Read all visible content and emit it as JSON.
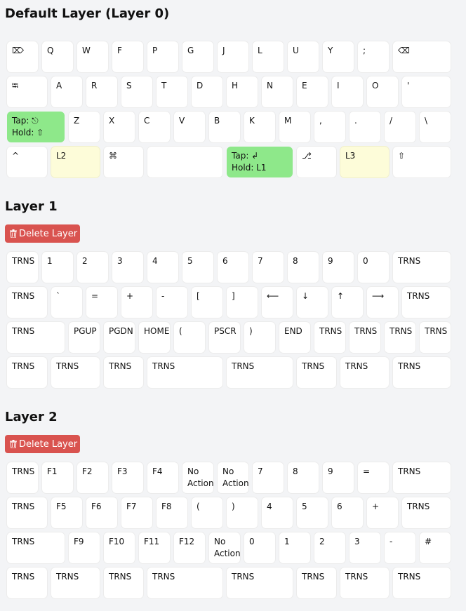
{
  "layers": [
    {
      "title": "Default Layer (Layer 0)",
      "delete_label": null,
      "rows": [
        [
          [
            "⌦"
          ],
          [
            "Q"
          ],
          [
            "W"
          ],
          [
            "F"
          ],
          [
            "P"
          ],
          [
            "G"
          ],
          [
            "J"
          ],
          [
            "L"
          ],
          [
            "U"
          ],
          [
            "Y"
          ],
          [
            ";"
          ],
          [
            "⌫"
          ]
        ],
        [
          [
            "⭾"
          ],
          [
            "A"
          ],
          [
            "R"
          ],
          [
            "S"
          ],
          [
            "T"
          ],
          [
            "D"
          ],
          [
            "H"
          ],
          [
            "N"
          ],
          [
            "E"
          ],
          [
            "I"
          ],
          [
            "O"
          ],
          [
            "'"
          ]
        ],
        [
          [
            "Tap: ⎋",
            "Hold: ⇧"
          ],
          [
            "Z"
          ],
          [
            "X"
          ],
          [
            "C"
          ],
          [
            "V"
          ],
          [
            "B"
          ],
          [
            "K"
          ],
          [
            "M"
          ],
          [
            ","
          ],
          [
            "."
          ],
          [
            "/"
          ],
          [
            "\\"
          ]
        ],
        [
          [
            "^"
          ],
          [
            "L2"
          ],
          [
            "⌘"
          ],
          [
            ""
          ],
          [
            "Tap: ↲",
            "Hold: L1"
          ],
          [
            "⎇"
          ],
          [
            "L3"
          ],
          [
            "⇧"
          ]
        ]
      ]
    },
    {
      "title": "Layer 1",
      "delete_label": "Delete Layer",
      "rows": [
        [
          [
            "TRNS"
          ],
          [
            "1"
          ],
          [
            "2"
          ],
          [
            "3"
          ],
          [
            "4"
          ],
          [
            "5"
          ],
          [
            "6"
          ],
          [
            "7"
          ],
          [
            "8"
          ],
          [
            "9"
          ],
          [
            "0"
          ],
          [
            "TRNS"
          ]
        ],
        [
          [
            "TRNS"
          ],
          [
            "`"
          ],
          [
            "="
          ],
          [
            "+"
          ],
          [
            "-"
          ],
          [
            "["
          ],
          [
            "]"
          ],
          [
            "⟵"
          ],
          [
            "↓"
          ],
          [
            "↑"
          ],
          [
            "⟶"
          ],
          [
            "TRNS"
          ]
        ],
        [
          [
            "TRNS"
          ],
          [
            "PGUP"
          ],
          [
            "PGDN"
          ],
          [
            "HOME"
          ],
          [
            "("
          ],
          [
            "PSCR"
          ],
          [
            ")"
          ],
          [
            "END"
          ],
          [
            "TRNS"
          ],
          [
            "TRNS"
          ],
          [
            "TRNS"
          ],
          [
            "TRNS"
          ]
        ],
        [
          [
            "TRNS"
          ],
          [
            "TRNS"
          ],
          [
            "TRNS"
          ],
          [
            "TRNS"
          ],
          [
            "TRNS"
          ],
          [
            "TRNS"
          ],
          [
            "TRNS"
          ],
          [
            "TRNS"
          ]
        ]
      ]
    },
    {
      "title": "Layer 2",
      "delete_label": "Delete Layer",
      "rows": [
        [
          [
            "TRNS"
          ],
          [
            "F1"
          ],
          [
            "F2"
          ],
          [
            "F3"
          ],
          [
            "F4"
          ],
          [
            "No",
            "Action"
          ],
          [
            "No",
            "Action"
          ],
          [
            "7"
          ],
          [
            "8"
          ],
          [
            "9"
          ],
          [
            "="
          ],
          [
            "TRNS"
          ]
        ],
        [
          [
            "TRNS"
          ],
          [
            "F5"
          ],
          [
            "F6"
          ],
          [
            "F7"
          ],
          [
            "F8"
          ],
          [
            "("
          ],
          [
            ")"
          ],
          [
            "4"
          ],
          [
            "5"
          ],
          [
            "6"
          ],
          [
            "+"
          ],
          [
            "TRNS"
          ]
        ],
        [
          [
            "TRNS"
          ],
          [
            "F9"
          ],
          [
            "F10"
          ],
          [
            "F11"
          ],
          [
            "F12"
          ],
          [
            "No",
            "Action"
          ],
          [
            "0"
          ],
          [
            "1"
          ],
          [
            "2"
          ],
          [
            "3"
          ],
          [
            "-"
          ],
          [
            "#"
          ]
        ],
        [
          [
            "TRNS"
          ],
          [
            "TRNS"
          ],
          [
            "TRNS"
          ],
          [
            "TRNS"
          ],
          [
            "TRNS"
          ],
          [
            "TRNS"
          ],
          [
            "TRNS"
          ],
          [
            "TRNS"
          ]
        ]
      ]
    }
  ],
  "colors": {
    "tap_hold": "#8ee88a",
    "layer_switch": "#fdfcd9",
    "delete_button": "#d9534f"
  }
}
